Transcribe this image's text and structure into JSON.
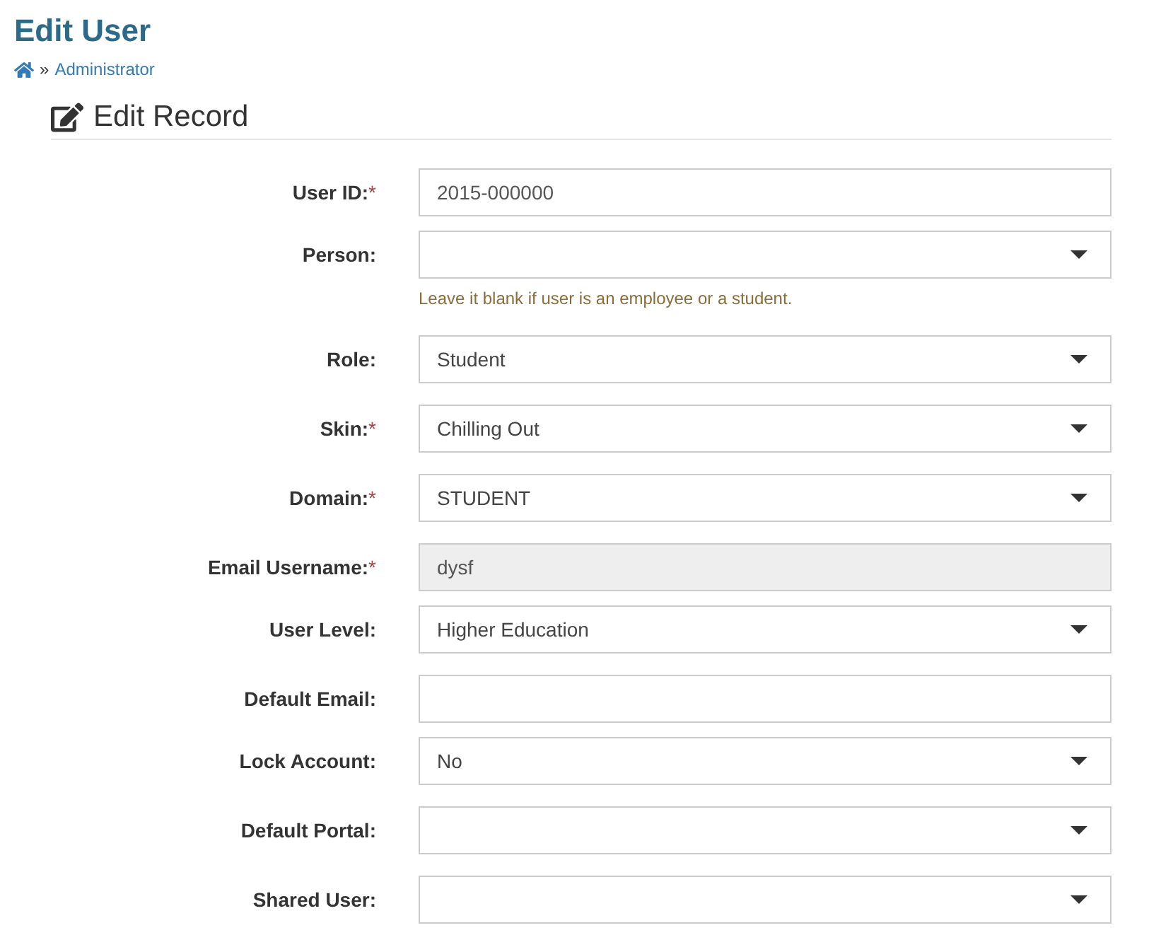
{
  "page": {
    "title": "Edit User"
  },
  "breadcrumb": {
    "separator": "»",
    "items": [
      {
        "label": "Administrator"
      }
    ]
  },
  "section": {
    "title": "Edit Record"
  },
  "fields": [
    {
      "label": "User ID:",
      "marker": "*",
      "kind": "text",
      "value": "2015-000000",
      "readonly": false
    },
    {
      "label": "Person:",
      "kind": "select",
      "readonly": false,
      "help": "Leave it blank if user is an employee or a student."
    },
    {
      "label": "Role:",
      "kind": "select",
      "value": "Student",
      "readonly": false
    },
    {
      "label": "Skin:",
      "marker": "*",
      "kind": "select",
      "value": "Chilling Out",
      "readonly": false
    },
    {
      "label": "Domain:",
      "marker": "*",
      "kind": "select",
      "value": "STUDENT",
      "readonly": false
    },
    {
      "label": "Email Username:",
      "marker": "*",
      "kind": "text",
      "value": "dysf",
      "readonly": true
    },
    {
      "label": "User Level:",
      "kind": "select",
      "value": "Higher Education",
      "readonly": false
    },
    {
      "label": "Default Email:",
      "kind": "text",
      "readonly": false
    },
    {
      "label": "Lock Account:",
      "kind": "select",
      "value": "No",
      "readonly": false
    },
    {
      "label": "Default Portal:",
      "kind": "select",
      "readonly": false
    },
    {
      "label": "Shared User:",
      "kind": "select",
      "readonly": false
    }
  ]
}
